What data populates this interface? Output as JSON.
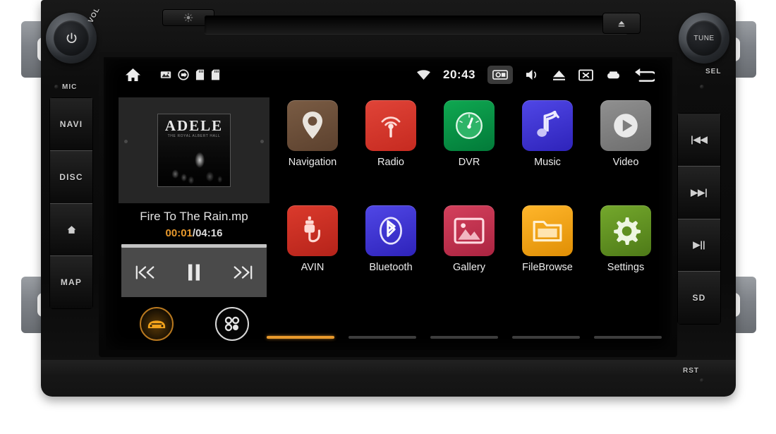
{
  "device": {
    "type": "android-car-head-unit",
    "knob_left": {
      "label": "VOL",
      "icon": "power-icon"
    },
    "knob_right": {
      "label": "TUNE",
      "sub_label": "SEL"
    },
    "mic_label": "MIC",
    "reset_label": "RST",
    "brightness_icon": "brightness-icon",
    "eject_icon": "eject-icon",
    "left_buttons": [
      {
        "label": "NAVI",
        "icon": ""
      },
      {
        "label": "DISC",
        "icon": ""
      },
      {
        "label": "",
        "icon": "home-icon"
      },
      {
        "label": "MAP",
        "icon": ""
      }
    ],
    "right_buttons": [
      {
        "label": "",
        "icon": "previous-track-icon",
        "glyph": "|◀◀"
      },
      {
        "label": "",
        "icon": "next-track-icon",
        "glyph": "▶▶|"
      },
      {
        "label": "",
        "icon": "play-pause-icon",
        "glyph": "▶||"
      },
      {
        "label": "SD",
        "icon": ""
      }
    ]
  },
  "statusbar": {
    "home_icon": "home-icon",
    "notifications": [
      "image-icon",
      "usb-disc-icon",
      "sd-card-icon",
      "sd-card-icon"
    ],
    "wifi_icon": "wifi-icon",
    "time": "20:43",
    "right_icons": [
      {
        "name": "screenshot-icon",
        "highlighted": true
      },
      {
        "name": "volume-icon",
        "highlighted": false
      },
      {
        "name": "eject-icon",
        "highlighted": false
      },
      {
        "name": "screen-off-icon",
        "highlighted": false
      },
      {
        "name": "recent-apps-icon",
        "highlighted": false
      },
      {
        "name": "back-icon",
        "highlighted": false
      }
    ]
  },
  "player": {
    "album_art": {
      "artist": "ADELE",
      "subtitle": "THE ROYAL ALBERT HALL"
    },
    "track_title": "Fire To The Rain.mp",
    "current_time": "00:01",
    "total_time": "/04:16",
    "progress_percent": 0.4,
    "controls": [
      {
        "name": "previous-button",
        "glyph": "❘≪"
      },
      {
        "name": "pause-button",
        "glyph": "❙❙"
      },
      {
        "name": "next-button",
        "glyph": "≫❘"
      }
    ],
    "shortcut_car": "car-mode-icon",
    "shortcut_apps": "app-drawer-icon"
  },
  "apps": {
    "row1": [
      {
        "label": "Navigation",
        "icon": "map-pin-icon",
        "color": "#6b4f3a"
      },
      {
        "label": "Radio",
        "icon": "broadcast-icon",
        "color": "#d7342b"
      },
      {
        "label": "DVR",
        "icon": "gauge-icon",
        "color": "#079447"
      },
      {
        "label": "Music",
        "icon": "music-note-icon",
        "color": "#3d32d4"
      },
      {
        "label": "Video",
        "icon": "play-icon",
        "color": "#7d7d7d"
      }
    ],
    "row2": [
      {
        "label": "AVIN",
        "icon": "plug-icon",
        "color": "#cf2e22"
      },
      {
        "label": "Bluetooth",
        "icon": "bluetooth-icon",
        "color": "#3d32d4"
      },
      {
        "label": "Gallery",
        "icon": "photo-icon",
        "color": "#c4334f"
      },
      {
        "label": "FileBrowse",
        "icon": "folder-icon",
        "color": "#f0a112"
      },
      {
        "label": "Settings",
        "icon": "gear-icon",
        "color": "#5f9021"
      }
    ]
  },
  "pager": {
    "pages": 5,
    "active": 1,
    "active_color": "#e8992c"
  }
}
